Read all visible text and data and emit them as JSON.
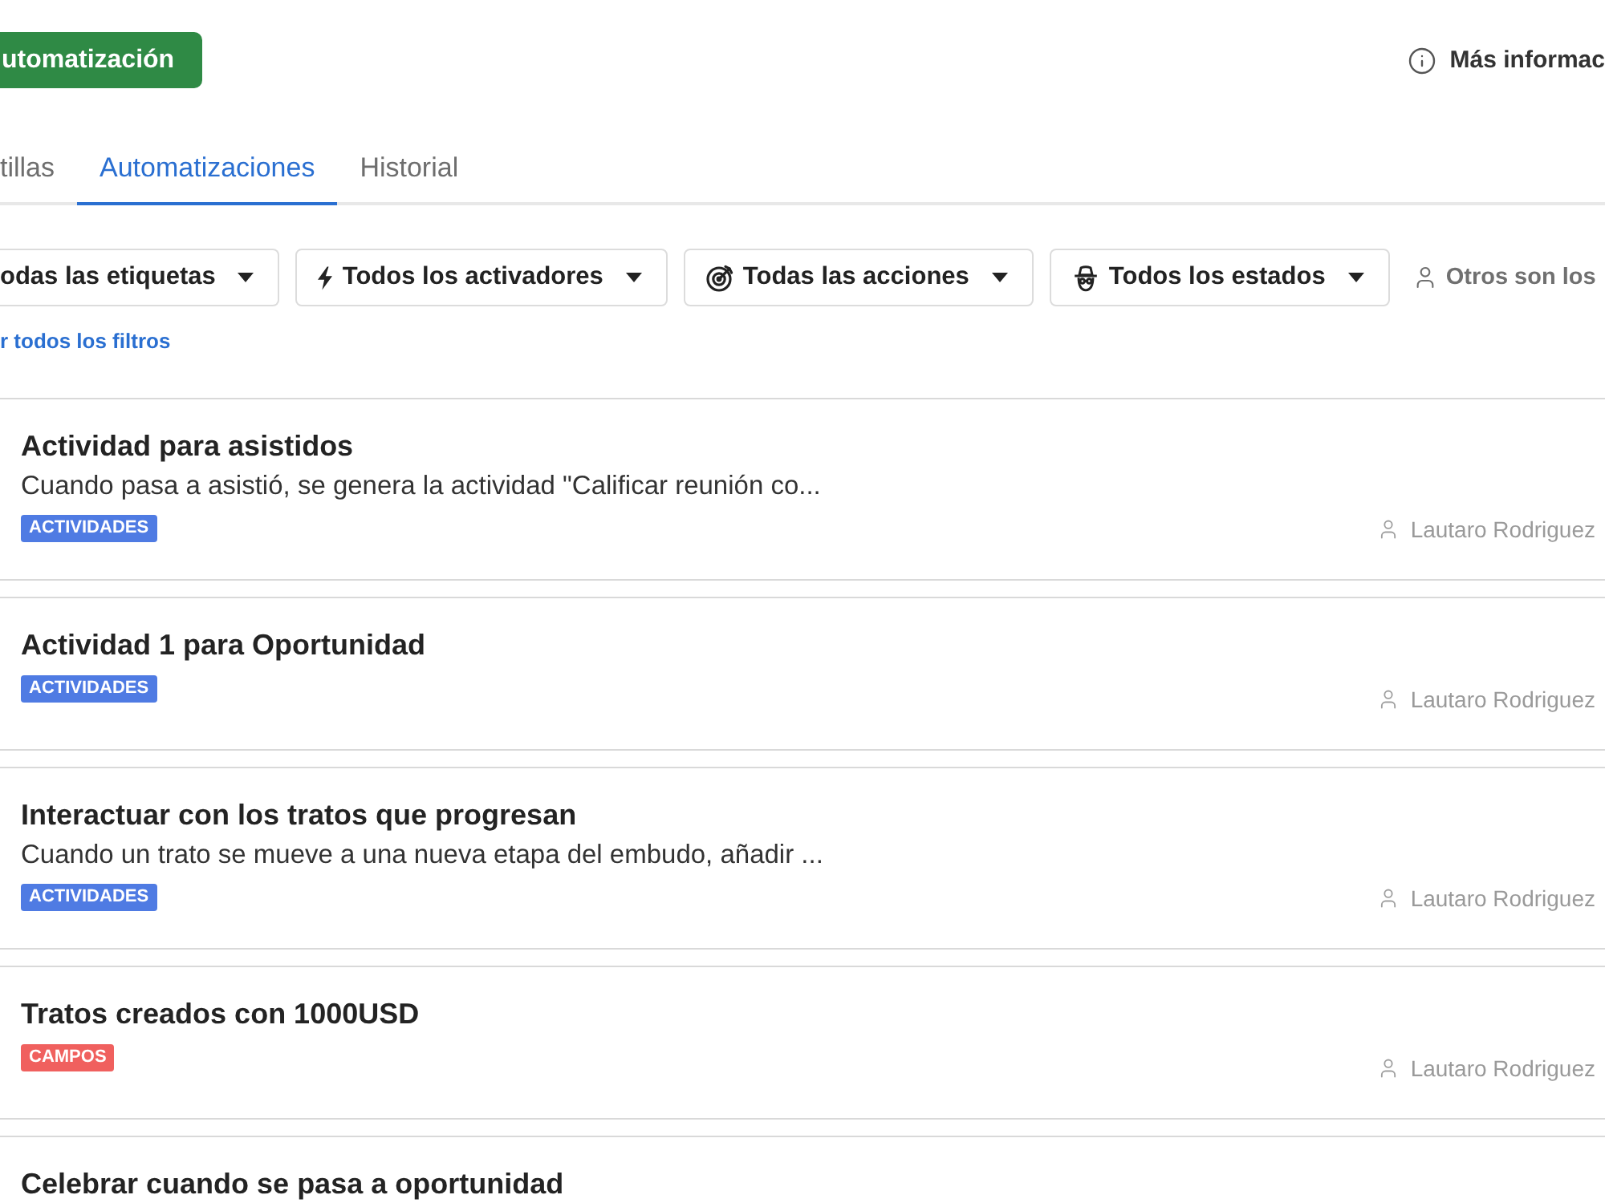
{
  "header": {
    "create_button": "utomatización",
    "info_link": "Más informac"
  },
  "tabs": [
    {
      "label": "tillas",
      "selected": false
    },
    {
      "label": "Automatizaciones",
      "selected": true
    },
    {
      "label": "Historial",
      "selected": false
    }
  ],
  "filters": [
    {
      "kind": "tags",
      "label": "odas las etiquetas"
    },
    {
      "kind": "triggers",
      "label": "Todos los activadores"
    },
    {
      "kind": "actions",
      "label": "Todas las acciones"
    },
    {
      "kind": "states",
      "label": "Todos los estados"
    }
  ],
  "owner_filter": {
    "label": "Otros son los"
  },
  "clear_filters": "r todos los filtros",
  "automations": [
    {
      "title": "Actividad para asistidos",
      "description": "Cuando pasa a asistió, se genera la actividad \"Calificar reunión co...",
      "tag": {
        "label": "ACTIVIDADES",
        "color": "#4f7be3"
      },
      "author": "Lautaro Rodriguez"
    },
    {
      "title": "Actividad 1 para Oportunidad",
      "tag": {
        "label": "ACTIVIDADES",
        "color": "#4f7be3"
      },
      "author": "Lautaro Rodriguez"
    },
    {
      "title": "Interactuar con los tratos que progresan",
      "description": "Cuando un trato se mueve a una nueva etapa del embudo, añadir ...",
      "tag": {
        "label": "ACTIVIDADES",
        "color": "#4f7be3"
      },
      "author": "Lautaro Rodriguez"
    },
    {
      "title": "Tratos creados con 1000USD",
      "tag": {
        "label": "CAMPOS",
        "color": "#f0605e"
      },
      "author": "Lautaro Rodriguez"
    },
    {
      "title": "Celebrar cuando se pasa a oportunidad"
    }
  ]
}
